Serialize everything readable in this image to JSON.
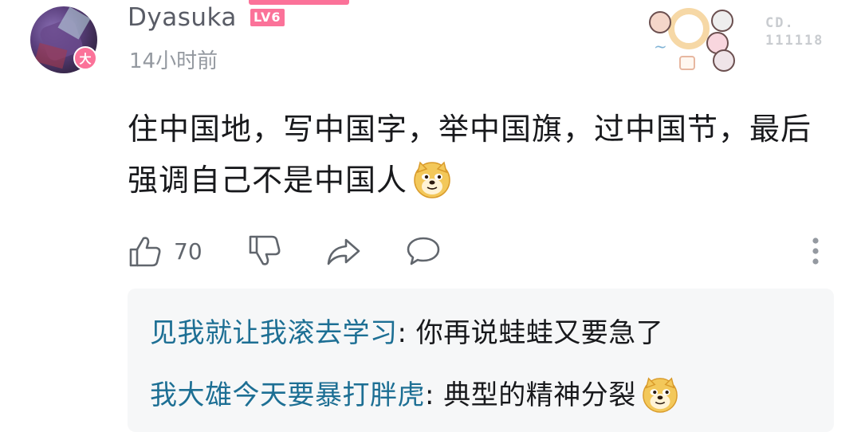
{
  "comment": {
    "username": "Dyasuka",
    "level": "LV6",
    "vip_badge": "大",
    "timestamp": "14小时前",
    "serial_lines": [
      "CD.",
      "111118"
    ],
    "content_text": "住中国地，写中国字，举中国旗，过中国节，最后强调自己不是中国人",
    "content_emoji": "doge-emoji",
    "like_count": "70",
    "accent_color": "#fb7299",
    "reply_name_color": "#1d6f94"
  },
  "actions": {
    "icons": [
      "thumbs-up-icon",
      "thumbs-down-icon",
      "share-icon",
      "comment-icon",
      "more-icon"
    ]
  },
  "replies": [
    {
      "username": "见我就让我滚去学习",
      "separator": ": ",
      "text": "你再说蛙蛙又要急了"
    },
    {
      "username": "我大雄今天要暴打胖虎",
      "separator": ": ",
      "text": "典型的精神分裂",
      "emoji": "doge-emoji"
    }
  ]
}
